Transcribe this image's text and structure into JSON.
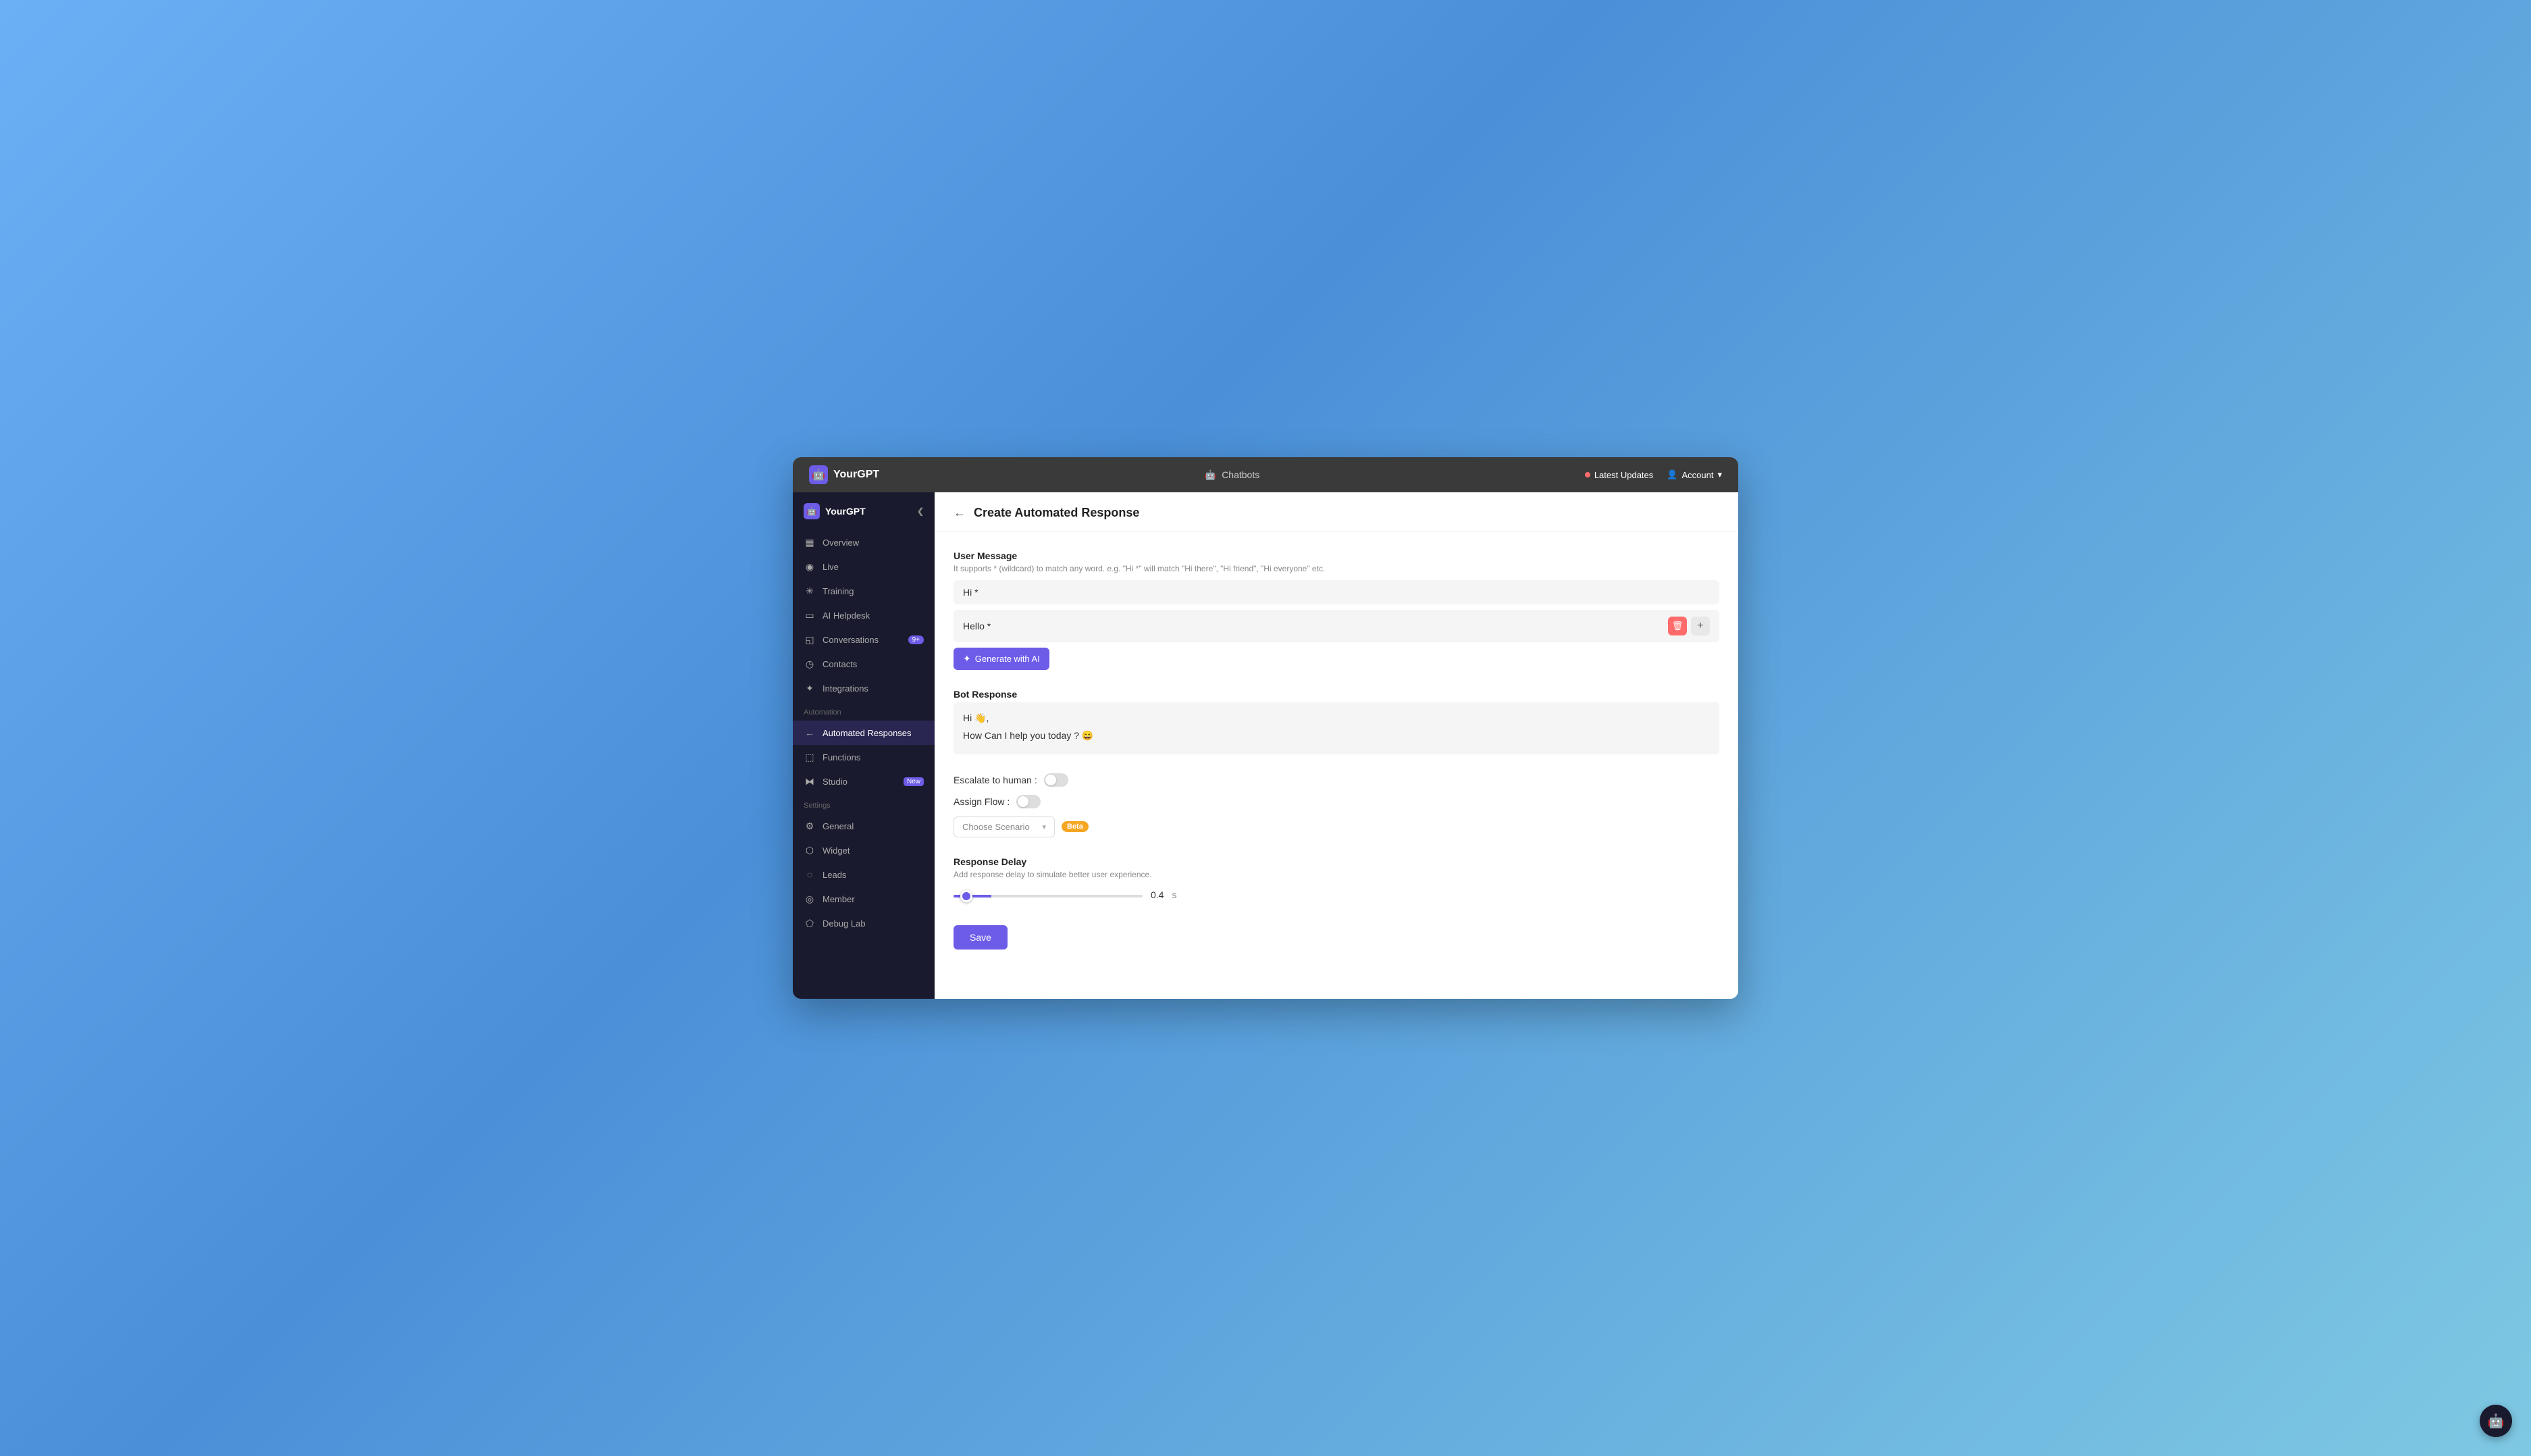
{
  "topNav": {
    "brand": "YourGPT",
    "chatbotsLabel": "Chatbots",
    "latestUpdates": "Latest Updates",
    "account": "Account",
    "chevron": "▾"
  },
  "sidebar": {
    "brand": "YourGPT",
    "collapseIcon": "❮",
    "nav": [
      {
        "id": "overview",
        "label": "Overview",
        "icon": "▦",
        "badge": null
      },
      {
        "id": "live",
        "label": "Live",
        "icon": "◉",
        "badge": null
      },
      {
        "id": "training",
        "label": "Training",
        "icon": "✳",
        "badge": null
      },
      {
        "id": "ai-helpdesk",
        "label": "AI Helpdesk",
        "icon": "▭",
        "badge": null
      },
      {
        "id": "conversations",
        "label": "Conversations",
        "icon": "◱",
        "badge": "9+"
      },
      {
        "id": "contacts",
        "label": "Contacts",
        "icon": "◷",
        "badge": null
      },
      {
        "id": "integrations",
        "label": "Integrations",
        "icon": "✦",
        "badge": null
      }
    ],
    "automationLabel": "Automation",
    "automation": [
      {
        "id": "automated-responses",
        "label": "Automated Responses",
        "icon": "←",
        "badge": null,
        "active": true
      },
      {
        "id": "functions",
        "label": "Functions",
        "icon": "⬚",
        "badge": null
      },
      {
        "id": "studio",
        "label": "Studio",
        "icon": "⧓",
        "badge": "New"
      }
    ],
    "settingsLabel": "Settings",
    "settings": [
      {
        "id": "general",
        "label": "General",
        "icon": "⚙",
        "badge": null
      },
      {
        "id": "widget",
        "label": "Widget",
        "icon": "⬡",
        "badge": null
      },
      {
        "id": "leads",
        "label": "Leads",
        "icon": "◌",
        "badge": null
      },
      {
        "id": "member",
        "label": "Member",
        "icon": "◎",
        "badge": null
      },
      {
        "id": "debug-lab",
        "label": "Debug Lab",
        "icon": "⬠",
        "badge": null
      }
    ]
  },
  "page": {
    "backIcon": "←",
    "title": "Create Automated Response",
    "userMessage": {
      "label": "User Message",
      "sublabel": "It supports * (wildcard) to match any word. e.g. \"Hi *\" will match \"Hi there\", \"Hi friend\", \"Hi everyone\" etc.",
      "messages": [
        {
          "text": "Hi *",
          "hasDelete": false
        },
        {
          "text": "Hello *",
          "hasDelete": true
        }
      ],
      "generateAI": "Generate with AI",
      "starsIcon": "✦"
    },
    "botResponse": {
      "label": "Bot Response",
      "lines": [
        "Hi 👋,",
        "How Can I help you today ? 😄"
      ]
    },
    "escalateToHuman": {
      "label": "Escalate to human :",
      "toggleState": "off"
    },
    "assignFlow": {
      "label": "Assign Flow :",
      "toggleState": "off",
      "choosePlaceholder": "Choose Scenario",
      "betaBadge": "Beta"
    },
    "responseDelay": {
      "label": "Response Delay",
      "sublabel": "Add response delay to simulate better user experience.",
      "value": "0.4",
      "unit": "s",
      "sliderMin": 0,
      "sliderMax": 10,
      "sliderStep": 0.1
    },
    "saveButton": "Save"
  },
  "fab": {
    "icon": "🤖"
  }
}
